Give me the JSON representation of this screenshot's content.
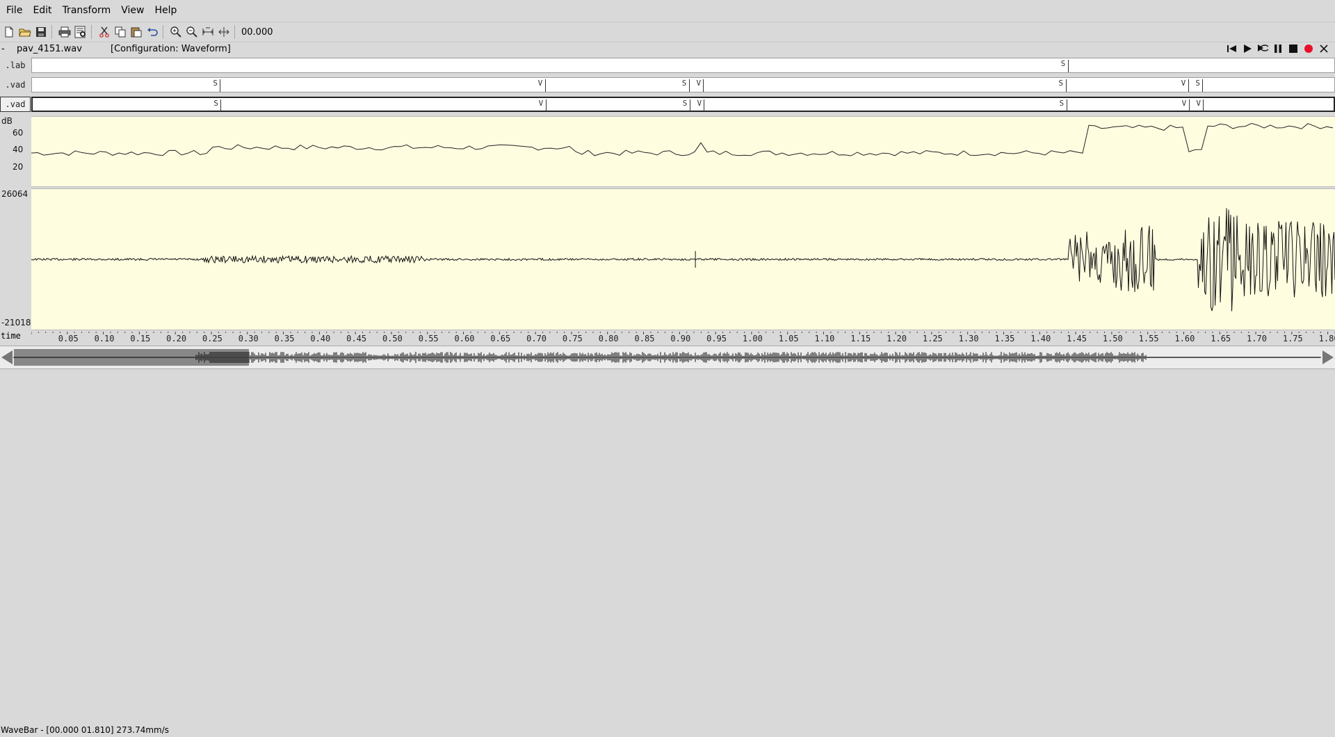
{
  "menu": {
    "file": "File",
    "edit": "Edit",
    "transform": "Transform",
    "view": "View",
    "help": "Help"
  },
  "toolbar": {
    "time": "00.000"
  },
  "filebar": {
    "dash": "-",
    "filename": "pav_4151.wav",
    "config": "[Configuration: Waveform]"
  },
  "tiers": [
    {
      "name": ".lab",
      "active": false,
      "marks": [
        {
          "t": 1.438,
          "label": "S"
        }
      ]
    },
    {
      "name": ".vad",
      "active": false,
      "marks": [
        {
          "t": 0.261,
          "label": "S"
        },
        {
          "t": 0.712,
          "label": "V"
        },
        {
          "t": 0.912,
          "label": "S"
        },
        {
          "t": 0.932,
          "label": "V"
        },
        {
          "t": 1.435,
          "label": "S"
        },
        {
          "t": 1.605,
          "label": "V"
        },
        {
          "t": 1.625,
          "label": "S"
        }
      ]
    },
    {
      "name": ".vad",
      "active": true,
      "marks": [
        {
          "t": 0.261,
          "label": "S"
        },
        {
          "t": 0.712,
          "label": "V"
        },
        {
          "t": 0.912,
          "label": "S"
        },
        {
          "t": 0.932,
          "label": "V"
        },
        {
          "t": 1.435,
          "label": "S"
        },
        {
          "t": 1.605,
          "label": "V"
        },
        {
          "t": 1.625,
          "label": "V"
        }
      ]
    }
  ],
  "energy": {
    "unit": "dB",
    "ticks": [
      "60",
      "40",
      "20"
    ],
    "tick_values": [
      60,
      40,
      20
    ],
    "range": [
      5,
      80
    ]
  },
  "waveform": {
    "max": "26064",
    "min": "-21018"
  },
  "time_axis": {
    "name": "time",
    "labels": [
      "0.05",
      "0.10",
      "0.15",
      "0.20",
      "0.25",
      "0.30",
      "0.35",
      "0.40",
      "0.45",
      "0.50",
      "0.55",
      "0.60",
      "0.65",
      "0.70",
      "0.75",
      "0.80",
      "0.85",
      "0.90",
      "0.95",
      "1.00",
      "1.05",
      "1.10",
      "1.15",
      "1.20",
      "1.25",
      "1.30",
      "1.35",
      "1.40",
      "1.45",
      "1.50",
      "1.55",
      "1.60",
      "1.65",
      "1.70",
      "1.75",
      "1.80"
    ],
    "duration": 1.81
  },
  "status": "WaveBar - [00.000 01.810] 273.74mm/s",
  "colors": {
    "panel_bg": "#fffde0",
    "record": "#e8102a",
    "page_bg": "#d9d9d9"
  }
}
